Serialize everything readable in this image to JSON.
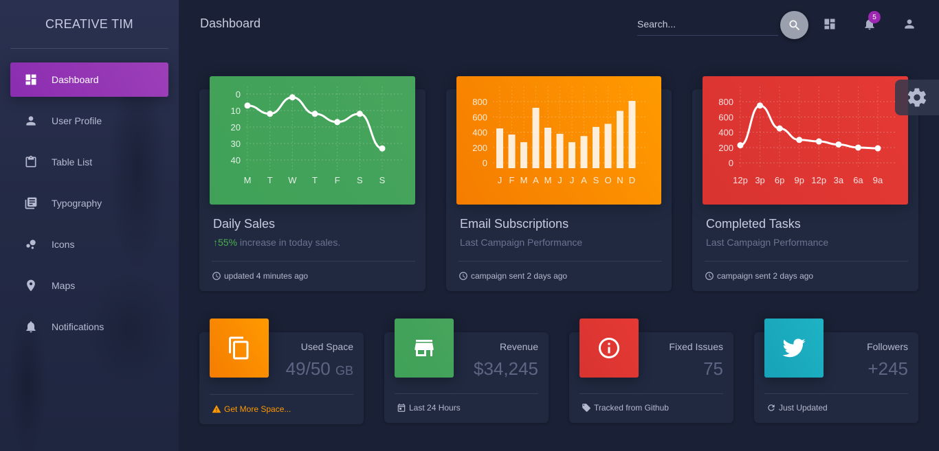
{
  "sidebar": {
    "logo": "CREATIVE TIM",
    "items": [
      {
        "label": "Dashboard",
        "icon": "dashboard-icon",
        "active": true
      },
      {
        "label": "User Profile",
        "icon": "person-icon"
      },
      {
        "label": "Table List",
        "icon": "clipboard-icon"
      },
      {
        "label": "Typography",
        "icon": "library-books-icon"
      },
      {
        "label": "Icons",
        "icon": "bubble-chart-icon"
      },
      {
        "label": "Maps",
        "icon": "location-icon"
      },
      {
        "label": "Notifications",
        "icon": "bell-icon"
      }
    ]
  },
  "topbar": {
    "title": "Dashboard",
    "search_placeholder": "Search...",
    "notification_count": "5"
  },
  "cards": [
    {
      "title": "Daily Sales",
      "sub_pct": "55%",
      "sub_text": " increase in today sales.",
      "footer": "updated 4 minutes ago"
    },
    {
      "title": "Email Subscriptions",
      "sub_text": "Last Campaign Performance",
      "footer": "campaign sent 2 days ago"
    },
    {
      "title": "Completed Tasks",
      "sub_text": "Last Campaign Performance",
      "footer": "campaign sent 2 days ago"
    }
  ],
  "stats": [
    {
      "label": "Used Space",
      "value": "49/50",
      "unit": "GB",
      "footer": "Get More Space...",
      "color": "#fb8c00"
    },
    {
      "label": "Revenue",
      "value": "$34,245",
      "footer": "Last 24 Hours",
      "color": "#43a047"
    },
    {
      "label": "Fixed Issues",
      "value": "75",
      "footer": "Tracked from Github",
      "color": "#e53935"
    },
    {
      "label": "Followers",
      "value": "+245",
      "footer": "Just Updated",
      "color": "#00acc1"
    }
  ],
  "chart_data": [
    {
      "type": "line",
      "categories": [
        "M",
        "T",
        "W",
        "T",
        "F",
        "S",
        "S"
      ],
      "values": [
        7,
        12,
        2,
        12,
        17,
        12,
        33
      ],
      "yticks": [
        0,
        10,
        20,
        30,
        40
      ],
      "ylim": [
        0,
        40
      ],
      "color": "#43a047"
    },
    {
      "type": "bar",
      "categories": [
        "J",
        "F",
        "M",
        "A",
        "M",
        "J",
        "J",
        "A",
        "S",
        "O",
        "N",
        "D"
      ],
      "values": [
        450,
        370,
        270,
        720,
        460,
        380,
        270,
        350,
        470,
        510,
        680,
        810
      ],
      "yticks": [
        0,
        200,
        400,
        600,
        800
      ],
      "ylim": [
        -70,
        900
      ],
      "color": "#fb8c00"
    },
    {
      "type": "line",
      "categories": [
        "12p",
        "3p",
        "6p",
        "9p",
        "12p",
        "3a",
        "6a",
        "9a"
      ],
      "values": [
        230,
        750,
        450,
        300,
        280,
        240,
        200,
        190
      ],
      "yticks": [
        0,
        200,
        400,
        600,
        800
      ],
      "ylim": [
        -70,
        900
      ],
      "color": "#e53935"
    }
  ]
}
